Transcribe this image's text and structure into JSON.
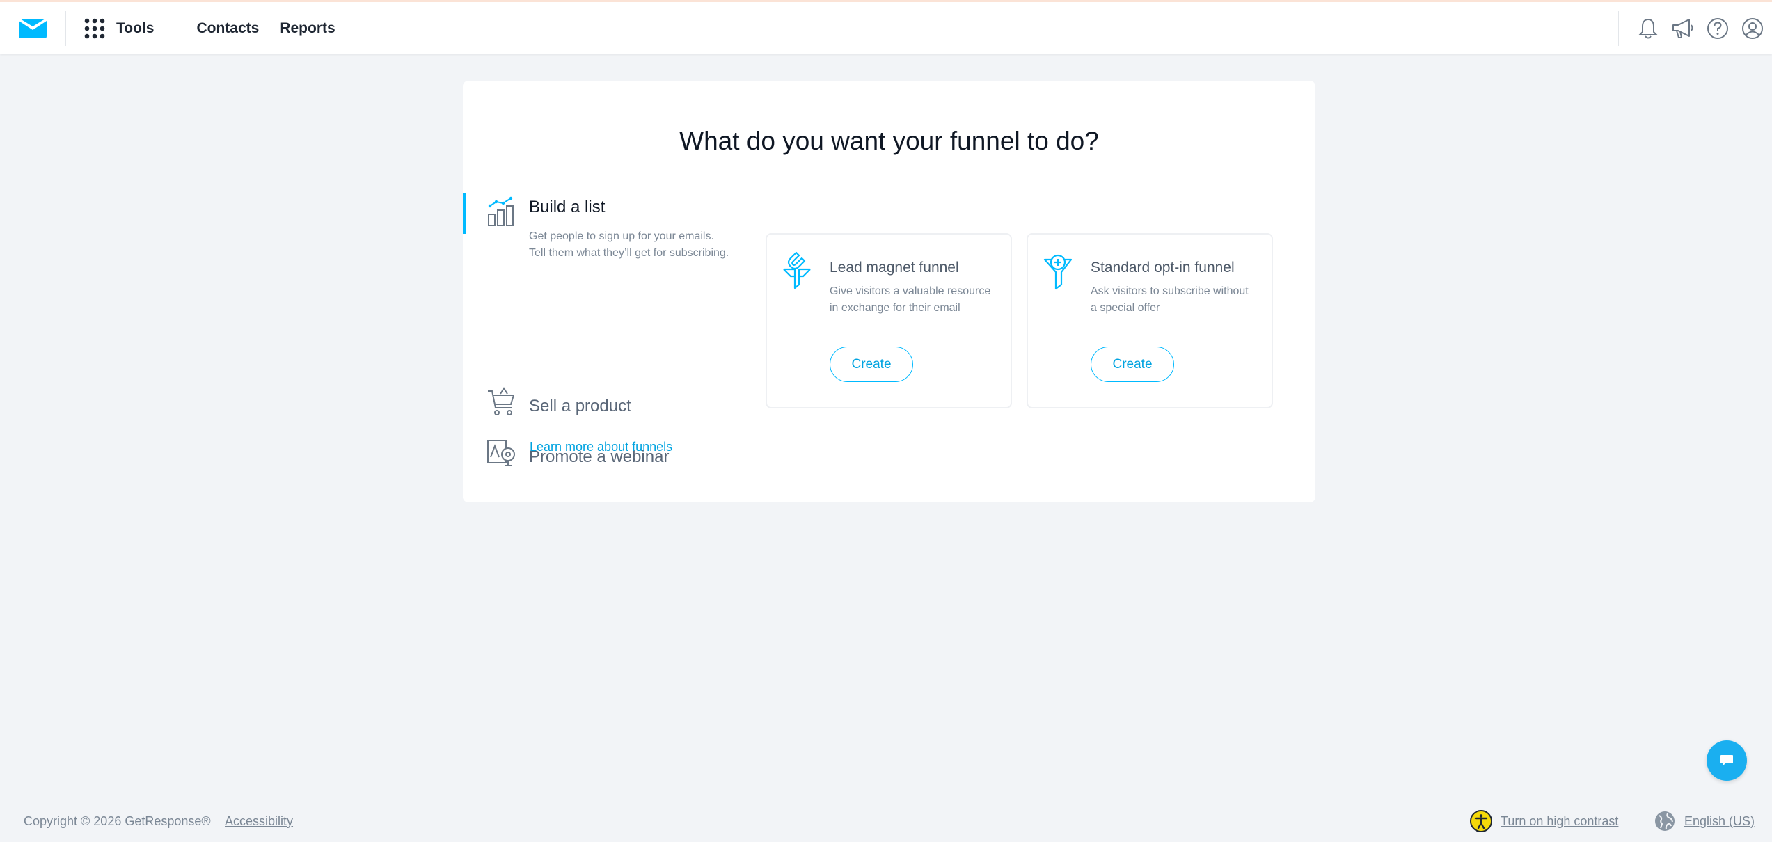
{
  "header": {
    "tools_label": "Tools",
    "nav": [
      "Contacts",
      "Reports"
    ],
    "icons": [
      "bell-icon",
      "megaphone-icon",
      "help-icon",
      "account-icon"
    ]
  },
  "colors": {
    "accent": "#00baff",
    "link": "#00a3e0",
    "background": "#f2f4f7"
  },
  "main": {
    "title": "What do you want your funnel to do?",
    "options": [
      {
        "title": "Build a list",
        "description": "Get people to sign up for your emails. Tell them what they’ll get for subscribing.",
        "icon": "chart-growth-icon",
        "active": true
      },
      {
        "title": "Sell a product",
        "icon": "shopping-cart-icon",
        "active": false
      },
      {
        "title": "Promote a webinar",
        "icon": "webinar-icon",
        "active": false
      }
    ],
    "learn_more": "Learn more about funnels",
    "funnels": [
      {
        "title": "Lead magnet funnel",
        "description": "Give visitors a valuable resource in exchange for their email",
        "button": "Create",
        "icon": "magnet-funnel-icon"
      },
      {
        "title": "Standard opt-in funnel",
        "description": "Ask visitors to subscribe without a special offer",
        "button": "Create",
        "icon": "opt-in-funnel-icon"
      }
    ]
  },
  "footer": {
    "copyright": "Copyright © 2026 GetResponse®",
    "accessibility": "Accessibility",
    "high_contrast": "Turn on high contrast",
    "language": "English (US)"
  }
}
